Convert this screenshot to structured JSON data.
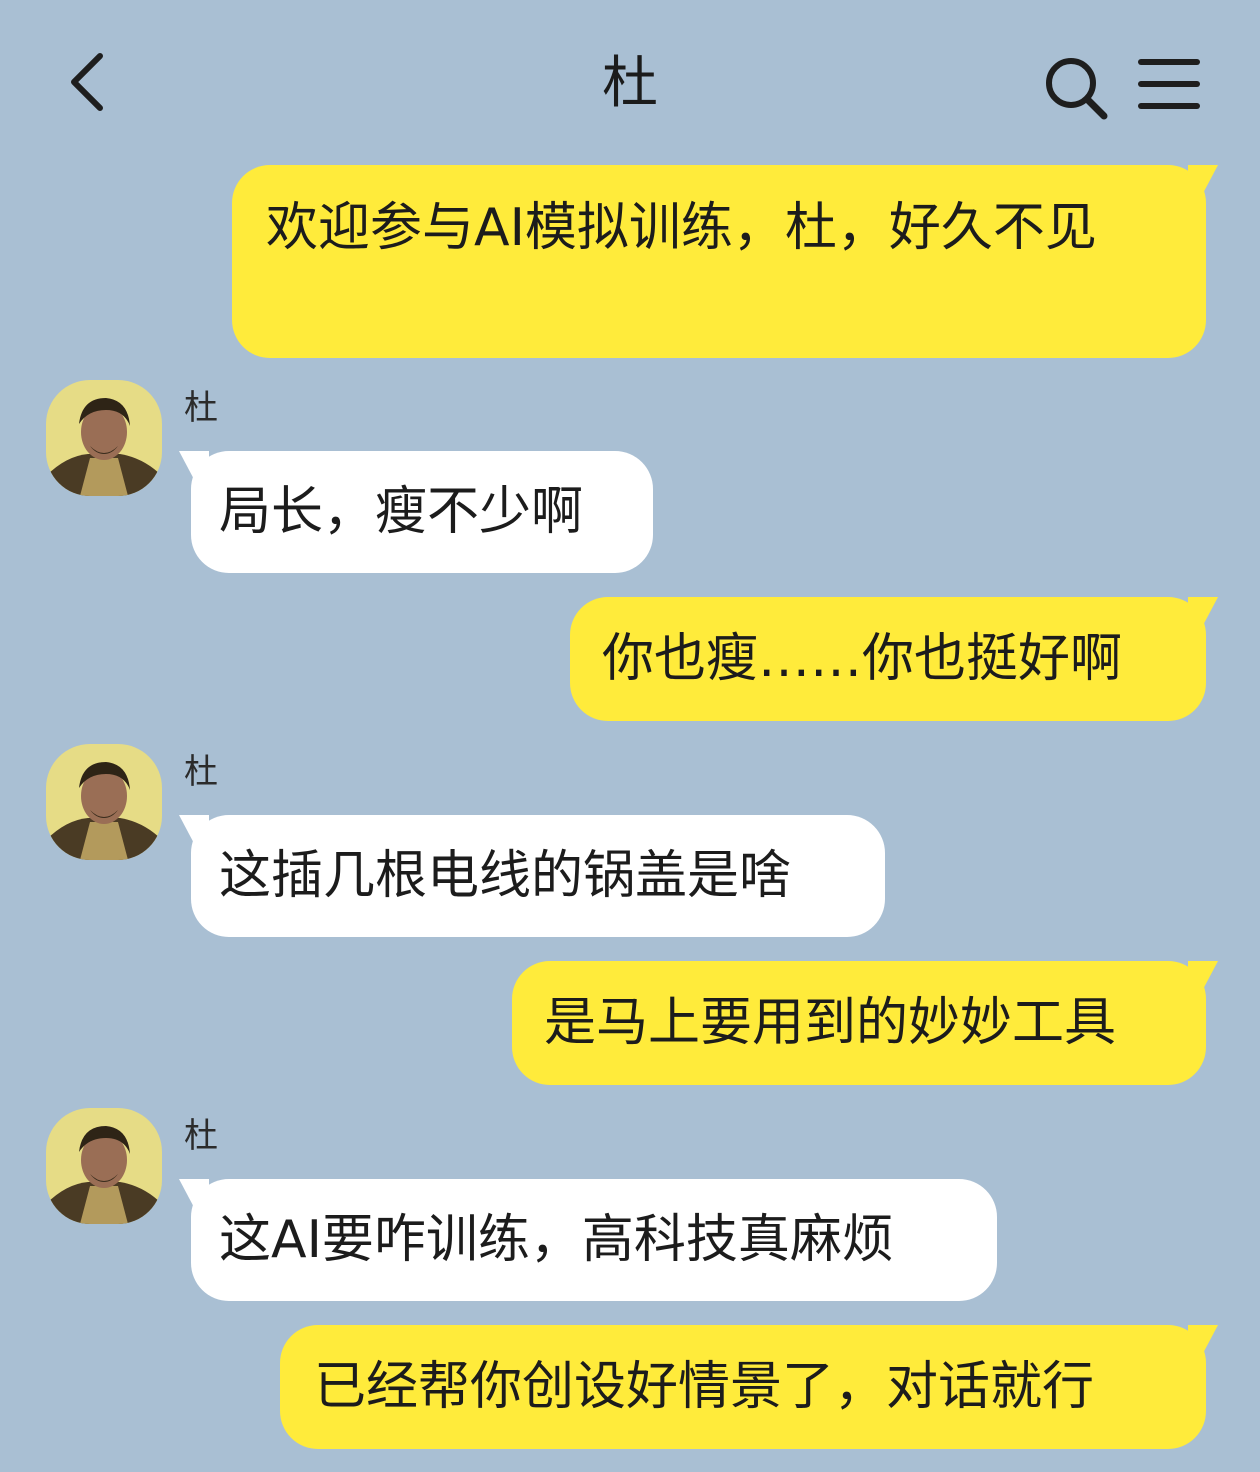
{
  "header": {
    "title": "杜"
  },
  "contact": {
    "name": "杜"
  },
  "messages": [
    {
      "side": "me",
      "text": "欢迎参与AI模拟训练，杜，好久不见"
    },
    {
      "side": "them",
      "sender": "杜",
      "text": "局长，瘦不少啊"
    },
    {
      "side": "me",
      "text": "你也瘦……你也挺好啊"
    },
    {
      "side": "them",
      "sender": "杜",
      "text": "这插几根电线的锅盖是啥"
    },
    {
      "side": "me",
      "text": "是马上要用到的妙妙工具"
    },
    {
      "side": "them",
      "sender": "杜",
      "text": "这AI要咋训练，高科技真麻烦"
    },
    {
      "side": "me",
      "text": "已经帮你创设好情景了，对话就行"
    }
  ],
  "colors": {
    "background": "#a9bfd3",
    "my_bubble": "#ffeb3b",
    "their_bubble": "#ffffff"
  },
  "icons": {
    "back": "back-chevron-icon",
    "search": "search-icon",
    "menu": "menu-icon"
  }
}
